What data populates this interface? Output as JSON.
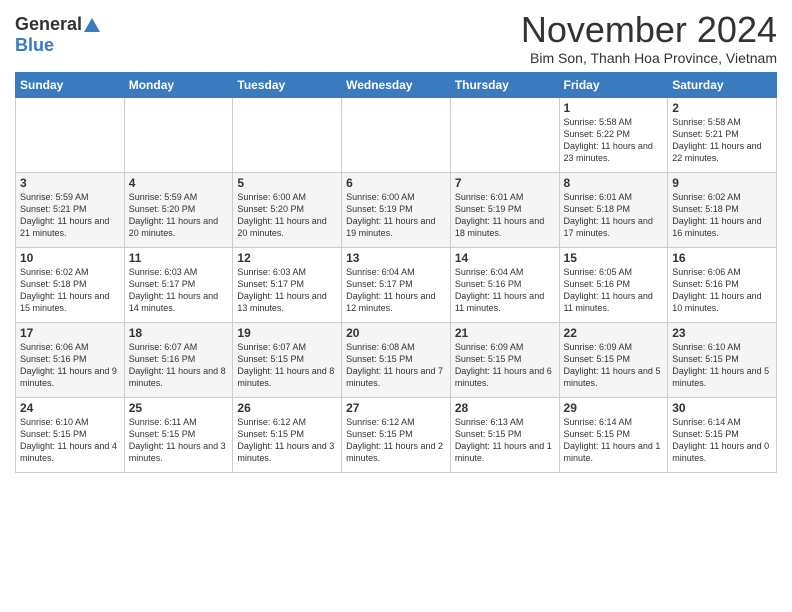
{
  "logo": {
    "general": "General",
    "blue": "Blue"
  },
  "header": {
    "month_title": "November 2024",
    "subtitle": "Bim Son, Thanh Hoa Province, Vietnam"
  },
  "days_of_week": [
    "Sunday",
    "Monday",
    "Tuesday",
    "Wednesday",
    "Thursday",
    "Friday",
    "Saturday"
  ],
  "weeks": [
    [
      {
        "day": "",
        "info": ""
      },
      {
        "day": "",
        "info": ""
      },
      {
        "day": "",
        "info": ""
      },
      {
        "day": "",
        "info": ""
      },
      {
        "day": "",
        "info": ""
      },
      {
        "day": "1",
        "info": "Sunrise: 5:58 AM\nSunset: 5:22 PM\nDaylight: 11 hours and 23 minutes."
      },
      {
        "day": "2",
        "info": "Sunrise: 5:58 AM\nSunset: 5:21 PM\nDaylight: 11 hours and 22 minutes."
      }
    ],
    [
      {
        "day": "3",
        "info": "Sunrise: 5:59 AM\nSunset: 5:21 PM\nDaylight: 11 hours and 21 minutes."
      },
      {
        "day": "4",
        "info": "Sunrise: 5:59 AM\nSunset: 5:20 PM\nDaylight: 11 hours and 20 minutes."
      },
      {
        "day": "5",
        "info": "Sunrise: 6:00 AM\nSunset: 5:20 PM\nDaylight: 11 hours and 20 minutes."
      },
      {
        "day": "6",
        "info": "Sunrise: 6:00 AM\nSunset: 5:19 PM\nDaylight: 11 hours and 19 minutes."
      },
      {
        "day": "7",
        "info": "Sunrise: 6:01 AM\nSunset: 5:19 PM\nDaylight: 11 hours and 18 minutes."
      },
      {
        "day": "8",
        "info": "Sunrise: 6:01 AM\nSunset: 5:18 PM\nDaylight: 11 hours and 17 minutes."
      },
      {
        "day": "9",
        "info": "Sunrise: 6:02 AM\nSunset: 5:18 PM\nDaylight: 11 hours and 16 minutes."
      }
    ],
    [
      {
        "day": "10",
        "info": "Sunrise: 6:02 AM\nSunset: 5:18 PM\nDaylight: 11 hours and 15 minutes."
      },
      {
        "day": "11",
        "info": "Sunrise: 6:03 AM\nSunset: 5:17 PM\nDaylight: 11 hours and 14 minutes."
      },
      {
        "day": "12",
        "info": "Sunrise: 6:03 AM\nSunset: 5:17 PM\nDaylight: 11 hours and 13 minutes."
      },
      {
        "day": "13",
        "info": "Sunrise: 6:04 AM\nSunset: 5:17 PM\nDaylight: 11 hours and 12 minutes."
      },
      {
        "day": "14",
        "info": "Sunrise: 6:04 AM\nSunset: 5:16 PM\nDaylight: 11 hours and 11 minutes."
      },
      {
        "day": "15",
        "info": "Sunrise: 6:05 AM\nSunset: 5:16 PM\nDaylight: 11 hours and 11 minutes."
      },
      {
        "day": "16",
        "info": "Sunrise: 6:06 AM\nSunset: 5:16 PM\nDaylight: 11 hours and 10 minutes."
      }
    ],
    [
      {
        "day": "17",
        "info": "Sunrise: 6:06 AM\nSunset: 5:16 PM\nDaylight: 11 hours and 9 minutes."
      },
      {
        "day": "18",
        "info": "Sunrise: 6:07 AM\nSunset: 5:16 PM\nDaylight: 11 hours and 8 minutes."
      },
      {
        "day": "19",
        "info": "Sunrise: 6:07 AM\nSunset: 5:15 PM\nDaylight: 11 hours and 8 minutes."
      },
      {
        "day": "20",
        "info": "Sunrise: 6:08 AM\nSunset: 5:15 PM\nDaylight: 11 hours and 7 minutes."
      },
      {
        "day": "21",
        "info": "Sunrise: 6:09 AM\nSunset: 5:15 PM\nDaylight: 11 hours and 6 minutes."
      },
      {
        "day": "22",
        "info": "Sunrise: 6:09 AM\nSunset: 5:15 PM\nDaylight: 11 hours and 5 minutes."
      },
      {
        "day": "23",
        "info": "Sunrise: 6:10 AM\nSunset: 5:15 PM\nDaylight: 11 hours and 5 minutes."
      }
    ],
    [
      {
        "day": "24",
        "info": "Sunrise: 6:10 AM\nSunset: 5:15 PM\nDaylight: 11 hours and 4 minutes."
      },
      {
        "day": "25",
        "info": "Sunrise: 6:11 AM\nSunset: 5:15 PM\nDaylight: 11 hours and 3 minutes."
      },
      {
        "day": "26",
        "info": "Sunrise: 6:12 AM\nSunset: 5:15 PM\nDaylight: 11 hours and 3 minutes."
      },
      {
        "day": "27",
        "info": "Sunrise: 6:12 AM\nSunset: 5:15 PM\nDaylight: 11 hours and 2 minutes."
      },
      {
        "day": "28",
        "info": "Sunrise: 6:13 AM\nSunset: 5:15 PM\nDaylight: 11 hours and 1 minute."
      },
      {
        "day": "29",
        "info": "Sunrise: 6:14 AM\nSunset: 5:15 PM\nDaylight: 11 hours and 1 minute."
      },
      {
        "day": "30",
        "info": "Sunrise: 6:14 AM\nSunset: 5:15 PM\nDaylight: 11 hours and 0 minutes."
      }
    ]
  ]
}
